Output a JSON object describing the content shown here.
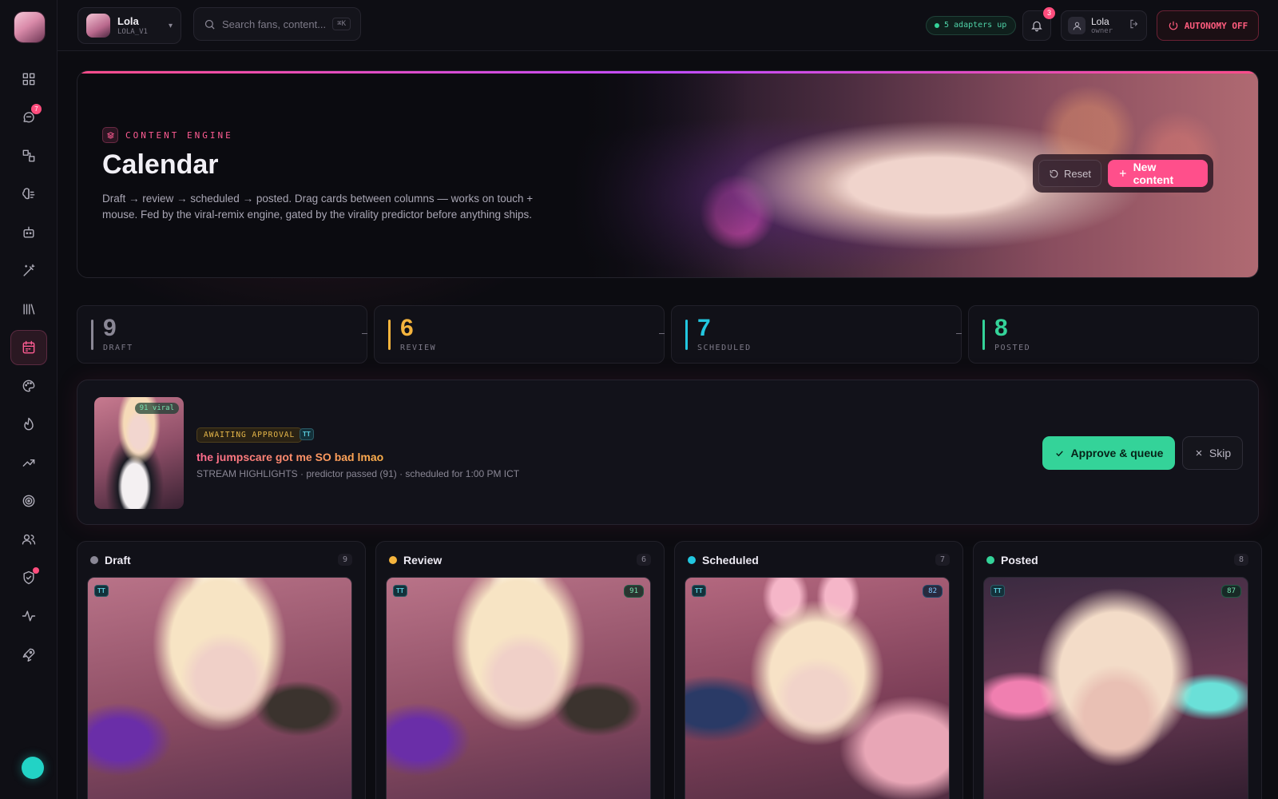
{
  "sidebar": {
    "items": [
      {
        "id": "dashboard",
        "icon": "grid-icon"
      },
      {
        "id": "messages",
        "icon": "chat-icon",
        "badge": "7"
      },
      {
        "id": "workflows",
        "icon": "flow-icon"
      },
      {
        "id": "brain",
        "icon": "brain-icon"
      },
      {
        "id": "bots",
        "icon": "robot-icon"
      },
      {
        "id": "magic",
        "icon": "wand-icon"
      },
      {
        "id": "library",
        "icon": "library-icon"
      },
      {
        "id": "calendar",
        "icon": "calendar-icon",
        "active": true
      },
      {
        "id": "palette",
        "icon": "palette-icon"
      },
      {
        "id": "trending",
        "icon": "flame-icon"
      },
      {
        "id": "growth",
        "icon": "trend-icon"
      },
      {
        "id": "targets",
        "icon": "target-icon"
      },
      {
        "id": "fans",
        "icon": "users-icon"
      },
      {
        "id": "safety",
        "icon": "shield-icon",
        "dot": true
      },
      {
        "id": "health",
        "icon": "pulse-icon"
      },
      {
        "id": "launch",
        "icon": "rocket-icon"
      }
    ]
  },
  "topbar": {
    "persona_name": "Lola",
    "persona_id": "LOLA_V1",
    "search_placeholder": "Search fans, content...",
    "search_shortcut": "⌘K",
    "adapters_status": "5 adapters up",
    "notifications_count": "3",
    "user_name": "Lola",
    "user_role": "owner",
    "autonomy_label": "AUTONOMY OFF"
  },
  "hero": {
    "eyebrow": "CONTENT ENGINE",
    "title": "Calendar",
    "description": "Draft → review → scheduled → posted. Drag cards between columns — works on touch + mouse. Fed by the viral-remix engine, gated by the virality predictor before anything ships.",
    "reset_label": "Reset",
    "new_label": "New content"
  },
  "stats": [
    {
      "value": "9",
      "label": "DRAFT",
      "color": "#8a8795"
    },
    {
      "value": "6",
      "label": "REVIEW",
      "color": "#f5b43d"
    },
    {
      "value": "7",
      "label": "SCHEDULED",
      "color": "#22c7e0"
    },
    {
      "value": "8",
      "label": "POSTED",
      "color": "#34d399"
    }
  ],
  "approval": {
    "thumb_badge": "91 viral",
    "status": "AWAITING APPROVAL",
    "platform": "TT",
    "title": "the jumpscare got me SO bad lmao",
    "meta": "STREAM HIGHLIGHTS · predictor passed (91) · scheduled for 1:00 PM ICT",
    "approve_label": "Approve & queue",
    "skip_label": "Skip"
  },
  "columns": [
    {
      "title": "Draft",
      "count": "9",
      "color": "#8a8795",
      "card_platform": "TT",
      "card_score": ""
    },
    {
      "title": "Review",
      "count": "6",
      "color": "#f5b43d",
      "card_platform": "TT",
      "card_score": "91"
    },
    {
      "title": "Scheduled",
      "count": "7",
      "color": "#22c7e0",
      "card_platform": "TT",
      "card_score": "82"
    },
    {
      "title": "Posted",
      "count": "8",
      "color": "#34d399",
      "card_platform": "TT",
      "card_score": "87"
    }
  ]
}
